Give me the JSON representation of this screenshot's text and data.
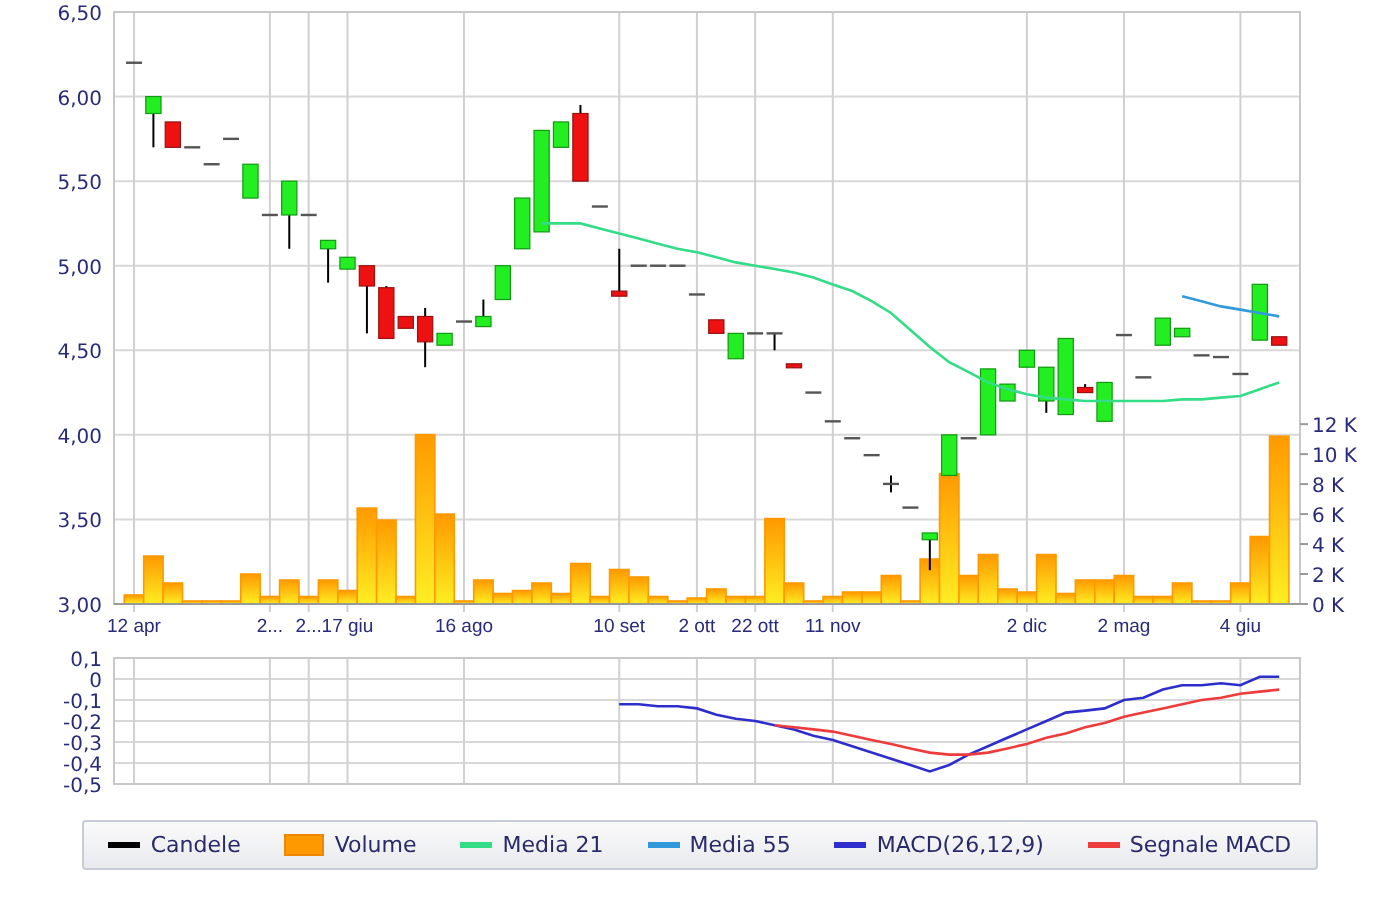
{
  "price_panel": {
    "candles_legend": {
      "label": "Candele",
      "color": "#000000"
    },
    "price_chart": {
      "chart_data": {
        "type": "candlestick",
        "categories": [
          "12 apr",
          null,
          null,
          null,
          null,
          null,
          null,
          "2...",
          null,
          "2...",
          null,
          "17 giu",
          null,
          null,
          null,
          null,
          null,
          "16 ago",
          null,
          null,
          null,
          null,
          null,
          null,
          null,
          "10 set",
          null,
          null,
          null,
          "2 ott",
          null,
          null,
          "22 ott",
          null,
          null,
          null,
          "11 nov",
          null,
          null,
          null,
          null,
          null,
          null,
          null,
          null,
          null,
          "2 dic",
          null,
          null,
          null,
          null,
          "2 mag",
          null,
          null,
          null,
          null,
          null,
          "4 giu",
          null,
          null
        ],
        "ylim": [
          3,
          6.5
        ],
        "y2lim": [
          0,
          39.5
        ],
        "grid": true,
        "y2ticks": [
          {
            "value": 0,
            "label": "0 K"
          },
          {
            "value": 2,
            "label": "2 K"
          },
          {
            "value": 4,
            "label": "4 K"
          },
          {
            "value": 6,
            "label": "6 K"
          },
          {
            "value": 8,
            "label": "8 K"
          },
          {
            "value": 10,
            "label": "10 K"
          },
          {
            "value": 12,
            "label": "12 K"
          }
        ],
        "yticks": [
          {
            "value": 3,
            "label": "3,00"
          },
          {
            "value": 3.5,
            "label": "3,50"
          },
          {
            "value": 4,
            "label": "4,00"
          },
          {
            "value": 4.5,
            "label": "4,50"
          },
          {
            "value": 5,
            "label": "5,00"
          },
          {
            "value": 5.5,
            "label": "5,50"
          },
          {
            "value": 6,
            "label": "6,00"
          },
          {
            "value": 6.5,
            "label": "6,50"
          }
        ],
        "ohlc": [
          [
            6.2,
            6.2,
            6.2,
            6.2
          ],
          [
            5.9,
            6.0,
            5.7,
            6.0
          ],
          [
            5.85,
            5.85,
            5.7,
            5.7
          ],
          [
            5.7,
            5.7,
            5.7,
            5.7
          ],
          [
            5.6,
            5.6,
            5.6,
            5.6
          ],
          [
            5.75,
            5.75,
            5.75,
            5.75
          ],
          [
            5.4,
            5.6,
            5.4,
            5.6
          ],
          [
            5.3,
            5.3,
            5.3,
            5.3
          ],
          [
            5.3,
            5.5,
            5.1,
            5.5
          ],
          [
            5.3,
            5.3,
            5.3,
            5.3
          ],
          [
            5.1,
            5.15,
            4.9,
            5.15
          ],
          [
            4.98,
            5.05,
            4.98,
            5.05
          ],
          [
            5.0,
            5.0,
            4.6,
            4.88
          ],
          [
            4.87,
            4.88,
            4.57,
            4.57
          ],
          [
            4.7,
            4.7,
            4.63,
            4.63
          ],
          [
            4.7,
            4.75,
            4.4,
            4.55
          ],
          [
            4.53,
            4.6,
            4.53,
            4.6
          ],
          [
            4.67,
            4.67,
            4.67,
            4.67
          ],
          [
            4.64,
            4.8,
            4.64,
            4.7
          ],
          [
            4.8,
            5.0,
            4.8,
            5.0
          ],
          [
            5.1,
            5.4,
            5.1,
            5.4
          ],
          [
            5.2,
            5.8,
            5.2,
            5.8
          ],
          [
            5.7,
            5.85,
            5.7,
            5.85
          ],
          [
            5.9,
            5.95,
            5.5,
            5.5
          ],
          [
            5.35,
            5.35,
            5.35,
            5.35
          ],
          [
            4.85,
            5.1,
            4.82,
            4.82
          ],
          [
            5.0,
            5.0,
            5.0,
            5.0
          ],
          [
            5.0,
            5.0,
            5.0,
            5.0
          ],
          [
            5.0,
            5.0,
            5.0,
            5.0
          ],
          [
            4.83,
            4.83,
            4.83,
            4.83
          ],
          [
            4.68,
            4.68,
            4.6,
            4.6
          ],
          [
            4.45,
            4.6,
            4.45,
            4.6
          ],
          [
            4.6,
            4.6,
            4.6,
            4.6
          ],
          [
            4.6,
            4.6,
            4.5,
            4.6
          ],
          [
            4.42,
            4.42,
            4.4,
            4.4
          ],
          [
            4.25,
            4.25,
            4.25,
            4.25
          ],
          [
            4.08,
            4.08,
            4.08,
            4.08
          ],
          [
            3.98,
            3.98,
            3.98,
            3.98
          ],
          [
            3.88,
            3.88,
            3.88,
            3.88
          ],
          [
            3.71,
            3.76,
            3.66,
            3.71
          ],
          [
            3.57,
            3.57,
            3.57,
            3.57
          ],
          [
            3.38,
            3.42,
            3.2,
            3.42
          ],
          [
            3.76,
            4.0,
            3.76,
            4.0
          ],
          [
            3.98,
            3.98,
            3.98,
            3.98
          ],
          [
            4.0,
            4.39,
            4.0,
            4.39
          ],
          [
            4.2,
            4.3,
            4.2,
            4.3
          ],
          [
            4.4,
            4.5,
            4.4,
            4.5
          ],
          [
            4.2,
            4.4,
            4.13,
            4.4
          ],
          [
            4.12,
            4.57,
            4.12,
            4.57
          ],
          [
            4.28,
            4.3,
            4.25,
            4.25
          ],
          [
            4.08,
            4.31,
            4.08,
            4.31
          ],
          [
            4.59,
            4.59,
            4.59,
            4.59
          ],
          [
            4.34,
            4.34,
            4.34,
            4.34
          ],
          [
            4.53,
            4.69,
            4.53,
            4.69
          ],
          [
            4.58,
            4.63,
            4.58,
            4.63
          ],
          [
            4.47,
            4.47,
            4.47,
            4.47
          ],
          [
            4.46,
            4.46,
            4.46,
            4.46
          ],
          [
            4.36,
            4.36,
            4.36,
            4.36
          ],
          [
            4.56,
            4.89,
            4.56,
            4.89
          ],
          [
            4.58,
            4.58,
            4.53,
            4.53
          ]
        ],
        "series": [
          {
            "name": "Volume",
            "type": "bar",
            "axis": "y2",
            "color": "#ff9900",
            "values": [
              0.6,
              3.2,
              1.4,
              0.2,
              0.2,
              0.2,
              2.0,
              0.5,
              1.6,
              0.5,
              1.6,
              0.9,
              6.4,
              5.6,
              0.5,
              11.3,
              6.0,
              0.2,
              1.6,
              0.7,
              0.9,
              1.4,
              0.7,
              2.7,
              0.5,
              2.3,
              1.8,
              0.5,
              0.2,
              0.4,
              1.0,
              0.5,
              0.5,
              5.7,
              1.4,
              0.2,
              0.5,
              0.8,
              0.8,
              1.9,
              0.2,
              3.0,
              8.7,
              1.9,
              3.3,
              1.0,
              0.8,
              3.3,
              0.7,
              1.6,
              1.6,
              1.9,
              0.5,
              0.5,
              1.4,
              0.2,
              0.2,
              1.4,
              4.5,
              11.2
            ]
          },
          {
            "name": "Media 21",
            "type": "line",
            "color": "#33dd88",
            "values": [
              null,
              null,
              null,
              null,
              null,
              null,
              null,
              null,
              null,
              null,
              null,
              null,
              null,
              null,
              null,
              null,
              null,
              null,
              null,
              null,
              null,
              5.25,
              5.25,
              5.25,
              5.22,
              5.19,
              5.16,
              5.13,
              5.1,
              5.08,
              5.05,
              5.02,
              5.0,
              4.98,
              4.96,
              4.93,
              4.89,
              4.85,
              4.79,
              4.72,
              4.62,
              4.52,
              4.43,
              4.37,
              4.31,
              4.27,
              4.24,
              4.22,
              4.21,
              4.2,
              4.2,
              4.2,
              4.2,
              4.2,
              4.21,
              4.21,
              4.22,
              4.23,
              4.27,
              4.31
            ]
          },
          {
            "name": "Media 55",
            "type": "line",
            "color": "#3399dd",
            "values": [
              null,
              null,
              null,
              null,
              null,
              null,
              null,
              null,
              null,
              null,
              null,
              null,
              null,
              null,
              null,
              null,
              null,
              null,
              null,
              null,
              null,
              null,
              null,
              null,
              null,
              null,
              null,
              null,
              null,
              null,
              null,
              null,
              null,
              null,
              null,
              null,
              null,
              null,
              null,
              null,
              null,
              null,
              null,
              null,
              null,
              null,
              null,
              null,
              null,
              null,
              null,
              null,
              null,
              null,
              4.82,
              4.79,
              4.76,
              4.74,
              4.72,
              4.7
            ]
          }
        ]
      }
    }
  },
  "macd_chart": {
    "chart_data": {
      "type": "line",
      "categories": [
        null,
        null,
        null,
        null,
        null,
        null,
        null,
        null,
        null,
        null,
        null,
        null,
        null,
        null,
        null,
        null,
        null,
        null,
        null,
        null,
        null,
        null,
        null,
        null,
        null,
        null,
        null,
        null,
        null,
        null,
        null,
        null,
        null,
        null,
        null,
        null,
        null,
        null,
        null,
        null,
        null,
        null,
        null,
        null,
        null,
        null,
        null,
        null,
        null,
        null,
        null,
        null,
        null,
        null,
        null,
        null,
        null,
        null,
        null,
        null
      ],
      "ylim": [
        -0.5,
        0.1
      ],
      "grid": true,
      "yticks": [
        {
          "value": 0.1,
          "label": "0,1"
        },
        {
          "value": 0,
          "label": "0"
        },
        {
          "value": -0.1,
          "label": "-0,1"
        },
        {
          "value": -0.2,
          "label": "-0,2"
        },
        {
          "value": -0.3,
          "label": "-0,3"
        },
        {
          "value": -0.4,
          "label": "-0,4"
        },
        {
          "value": -0.5,
          "label": "-0,5"
        }
      ],
      "series": [
        {
          "name": "MACD(26,12,9)",
          "color": "#2e2ecc",
          "values": [
            null,
            null,
            null,
            null,
            null,
            null,
            null,
            null,
            null,
            null,
            null,
            null,
            null,
            null,
            null,
            null,
            null,
            null,
            null,
            null,
            null,
            null,
            null,
            null,
            null,
            -0.12,
            -0.12,
            -0.13,
            -0.13,
            -0.14,
            -0.17,
            -0.19,
            -0.2,
            -0.22,
            -0.24,
            -0.27,
            -0.29,
            -0.32,
            -0.35,
            -0.38,
            -0.41,
            -0.44,
            -0.41,
            -0.36,
            -0.32,
            -0.28,
            -0.24,
            -0.2,
            -0.16,
            -0.15,
            -0.14,
            -0.1,
            -0.09,
            -0.05,
            -0.03,
            -0.03,
            -0.02,
            -0.03,
            0.01,
            0.01
          ]
        },
        {
          "name": "Segnale MACD",
          "color": "#ee3b3b",
          "values": [
            null,
            null,
            null,
            null,
            null,
            null,
            null,
            null,
            null,
            null,
            null,
            null,
            null,
            null,
            null,
            null,
            null,
            null,
            null,
            null,
            null,
            null,
            null,
            null,
            null,
            null,
            null,
            null,
            null,
            null,
            null,
            null,
            null,
            -0.22,
            -0.23,
            -0.24,
            -0.25,
            -0.27,
            -0.29,
            -0.31,
            -0.33,
            -0.35,
            -0.36,
            -0.36,
            -0.35,
            -0.33,
            -0.31,
            -0.28,
            -0.26,
            -0.23,
            -0.21,
            -0.18,
            -0.16,
            -0.14,
            -0.12,
            -0.1,
            -0.09,
            -0.07,
            -0.06,
            -0.05
          ]
        }
      ]
    }
  }
}
